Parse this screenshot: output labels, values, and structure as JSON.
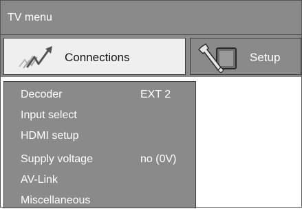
{
  "window": {
    "title": "TV menu"
  },
  "tabs": [
    {
      "label": "Connections",
      "icon": "connections-icon",
      "selected": true
    },
    {
      "label": "Setup",
      "icon": "setup-icon",
      "selected": false
    }
  ],
  "menu": {
    "items": [
      {
        "label": "Decoder",
        "value": "EXT 2"
      },
      {
        "label": "Input select",
        "value": ""
      },
      {
        "label": "HDMI setup",
        "value": ""
      },
      {
        "label": "Supply voltage",
        "value": "no (0V)"
      },
      {
        "label": "AV-Link",
        "value": ""
      },
      {
        "label": "Miscellaneous",
        "value": ""
      }
    ]
  },
  "colors": {
    "menu_background": "#8a8a8a",
    "selected_tab_background": "#efefef",
    "text_on_grey": "#ffffff",
    "text_on_light": "#111111"
  }
}
